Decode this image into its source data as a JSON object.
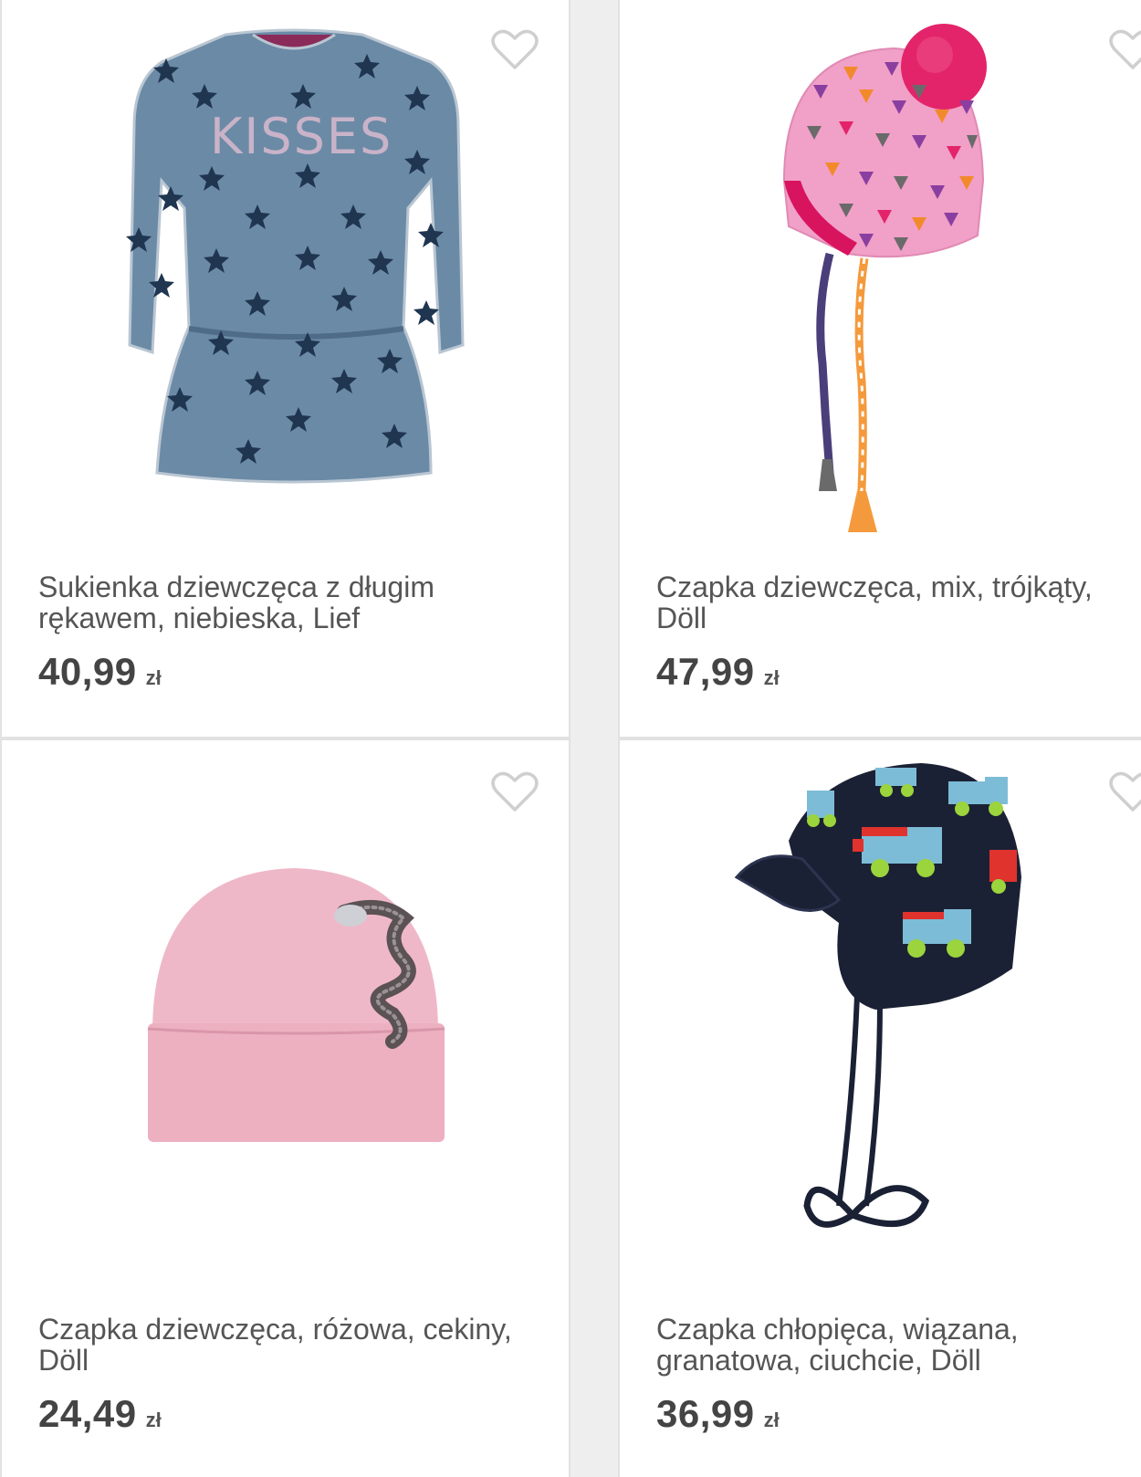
{
  "products": [
    {
      "name": "Sukienka dziewczęca z długim rękawem, niebieska, Lief",
      "price": "40,99",
      "currency": "zł",
      "image_icon": "dress-image"
    },
    {
      "name": "Czapka dziewczęca, mix, trójkąty, Döll",
      "price": "47,99",
      "currency": "zł",
      "image_icon": "pompom-hat-image"
    },
    {
      "name": "Czapka dziewczęca, różowa, cekiny, Döll",
      "price": "24,49",
      "currency": "zł",
      "image_icon": "beanie-image"
    },
    {
      "name": "Czapka chłopięca, wiązana, granatowa, ciuchcie, Döll",
      "price": "36,99",
      "currency": "zł",
      "image_icon": "train-cap-image"
    }
  ],
  "colors": {
    "heart_outline": "#cfcfcf",
    "text": "#555555",
    "price": "#444444"
  }
}
